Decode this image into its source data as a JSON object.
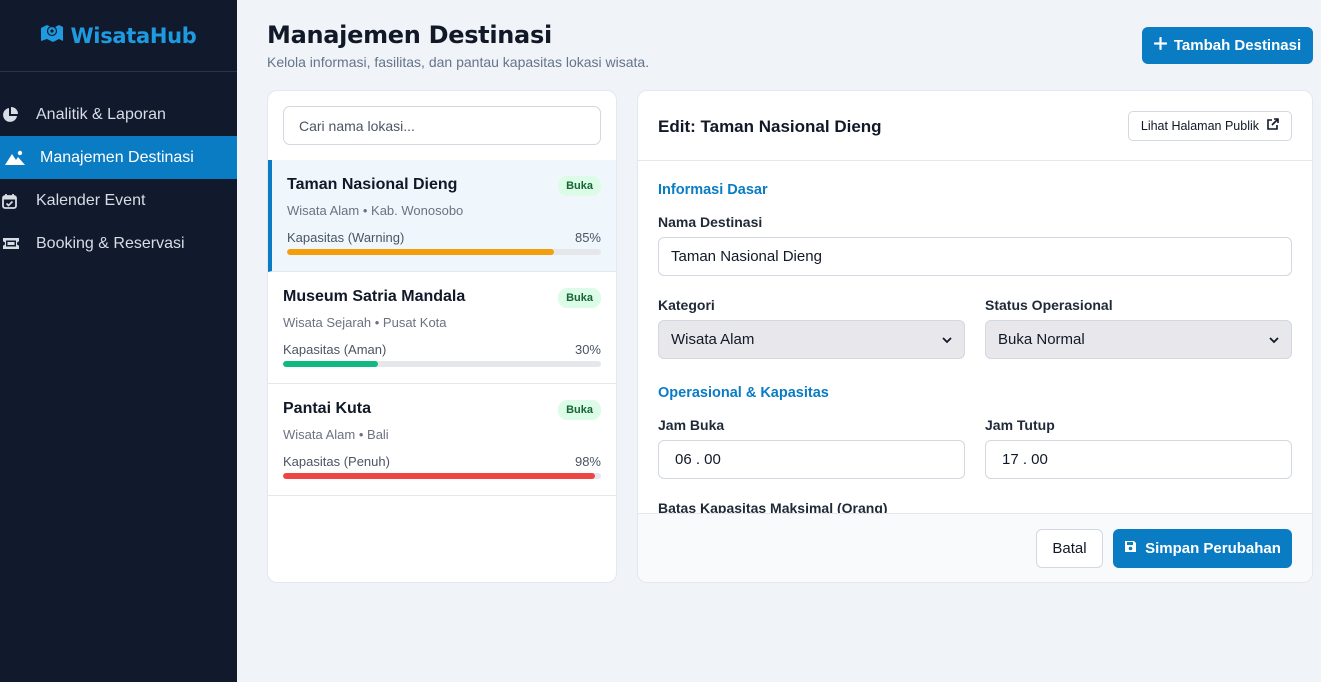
{
  "brand": {
    "name": "WisataHub",
    "icon": "map-icon",
    "color": "#1e9be0"
  },
  "sidebar": {
    "items": [
      {
        "label": "Analitik & Laporan",
        "icon": "pie-chart-icon"
      },
      {
        "label": "Manajemen Destinasi",
        "icon": "mountain-icon",
        "active": true
      },
      {
        "label": "Kalender Event",
        "icon": "calendar-check-icon"
      },
      {
        "label": "Booking & Reservasi",
        "icon": "ticket-icon"
      }
    ]
  },
  "header": {
    "title": "Manajemen Destinasi",
    "subtitle": "Kelola informasi, fasilitas, dan pantau kapasitas lokasi wisata.",
    "add_button": "Tambah Destinasi"
  },
  "search": {
    "placeholder": "Cari nama lokasi..."
  },
  "destinations": [
    {
      "name": "Taman Nasional Dieng",
      "badge": "Buka",
      "meta": "Wisata Alam • Kab. Wonosobo",
      "capacity_label": "Kapasitas (Warning)",
      "capacity_pct_text": "85%",
      "capacity": 85,
      "bar_color": "#f59e0b",
      "active": true
    },
    {
      "name": "Museum Satria Mandala",
      "badge": "Buka",
      "meta": "Wisata Sejarah • Pusat Kota",
      "capacity_label": "Kapasitas (Aman)",
      "capacity_pct_text": "30%",
      "capacity": 30,
      "bar_color": "#10b981"
    },
    {
      "name": "Pantai Kuta",
      "badge": "Buka",
      "meta": "Wisata Alam • Bali",
      "capacity_label": "Kapasitas (Penuh)",
      "capacity_pct_text": "98%",
      "capacity": 98,
      "bar_color": "#ef4444"
    }
  ],
  "edit": {
    "title": "Edit: Taman Nasional Dieng",
    "public_button": "Lihat Halaman Publik",
    "section_basic": "Informasi Dasar",
    "name_label": "Nama Destinasi",
    "name_value": "Taman Nasional Dieng",
    "category_label": "Kategori",
    "category_value": "Wisata Alam",
    "status_label": "Status Operasional",
    "status_value": "Buka Normal",
    "section_ops": "Operasional & Kapasitas",
    "open_label": "Jam Buka",
    "open_value": "06 . 00",
    "close_label": "Jam Tutup",
    "close_value": "17 . 00",
    "max_capacity_label": "Batas Kapasitas Maksimal (Orang)",
    "cancel_button": "Batal",
    "save_button": "Simpan Perubahan"
  },
  "colors": {
    "accent": "#0a7cc4",
    "sidebar_bg": "#111a2d",
    "badge_bg": "#dcfce7",
    "badge_text": "#166534"
  }
}
